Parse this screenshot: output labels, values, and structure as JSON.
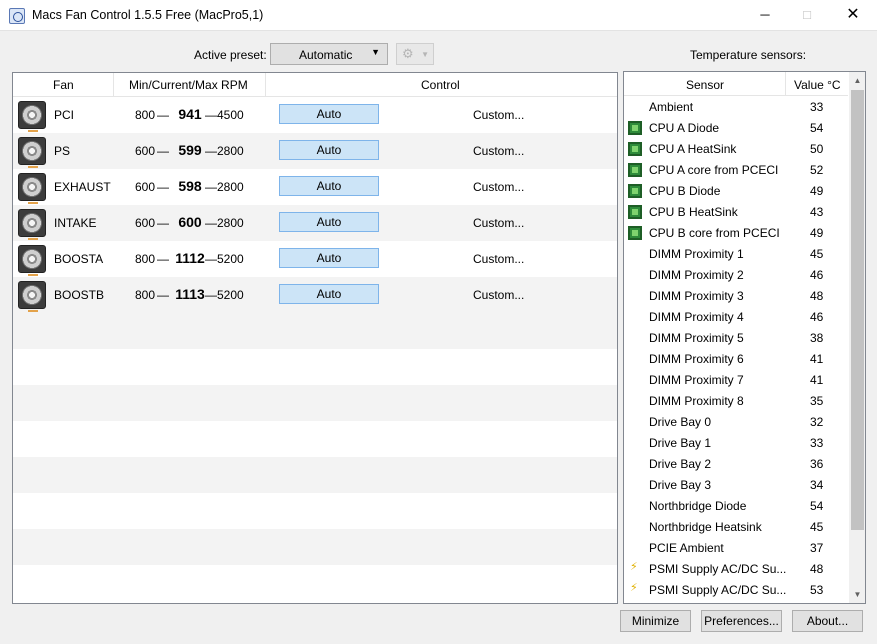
{
  "window": {
    "title": "Macs Fan Control 1.5.5 Free (MacPro5,1)",
    "minimize_glyph": "─",
    "maximize_glyph": "□",
    "close_glyph": "✕"
  },
  "toolbar": {
    "preset_label": "Active preset:",
    "preset_value": "Automatic",
    "dropdown_arrow": "▼",
    "gear_icon": "⚙",
    "temperature_label": "Temperature sensors:"
  },
  "fan_table": {
    "headers": {
      "fan": "Fan",
      "rpm": "Min/Current/Max RPM",
      "control": "Control"
    },
    "dash": "—",
    "fans": [
      {
        "name": "PCI",
        "min": "800",
        "current": "941",
        "max": "4500",
        "control": "Auto",
        "custom": "Custom..."
      },
      {
        "name": "PS",
        "min": "600",
        "current": "599",
        "max": "2800",
        "control": "Auto",
        "custom": "Custom..."
      },
      {
        "name": "EXHAUST",
        "min": "600",
        "current": "598",
        "max": "2800",
        "control": "Auto",
        "custom": "Custom..."
      },
      {
        "name": "INTAKE",
        "min": "600",
        "current": "600",
        "max": "2800",
        "control": "Auto",
        "custom": "Custom..."
      },
      {
        "name": "BOOSTA",
        "min": "800",
        "current": "1112",
        "max": "5200",
        "control": "Auto",
        "custom": "Custom..."
      },
      {
        "name": "BOOSTB",
        "min": "800",
        "current": "1113",
        "max": "5200",
        "control": "Auto",
        "custom": "Custom..."
      }
    ]
  },
  "sensor_table": {
    "headers": {
      "sensor": "Sensor",
      "value": "Value °C"
    },
    "sensors": [
      {
        "name": "Ambient",
        "value": "33",
        "icon": "none"
      },
      {
        "name": "CPU A Diode",
        "value": "54",
        "icon": "chip-icon"
      },
      {
        "name": "CPU A HeatSink",
        "value": "50",
        "icon": "chip-icon"
      },
      {
        "name": "CPU A core from PCECI",
        "value": "52",
        "icon": "chip-icon"
      },
      {
        "name": "CPU B Diode",
        "value": "49",
        "icon": "chip-icon"
      },
      {
        "name": "CPU B HeatSink",
        "value": "43",
        "icon": "chip-icon"
      },
      {
        "name": "CPU B core from PCECI",
        "value": "49",
        "icon": "chip-icon"
      },
      {
        "name": "DIMM Proximity 1",
        "value": "45",
        "icon": "none"
      },
      {
        "name": "DIMM Proximity 2",
        "value": "46",
        "icon": "none"
      },
      {
        "name": "DIMM Proximity 3",
        "value": "48",
        "icon": "none"
      },
      {
        "name": "DIMM Proximity 4",
        "value": "46",
        "icon": "none"
      },
      {
        "name": "DIMM Proximity 5",
        "value": "38",
        "icon": "none"
      },
      {
        "name": "DIMM Proximity 6",
        "value": "41",
        "icon": "none"
      },
      {
        "name": "DIMM Proximity 7",
        "value": "41",
        "icon": "none"
      },
      {
        "name": "DIMM Proximity 8",
        "value": "35",
        "icon": "none"
      },
      {
        "name": "Drive Bay 0",
        "value": "32",
        "icon": "none"
      },
      {
        "name": "Drive Bay 1",
        "value": "33",
        "icon": "none"
      },
      {
        "name": "Drive Bay 2",
        "value": "36",
        "icon": "none"
      },
      {
        "name": "Drive Bay 3",
        "value": "34",
        "icon": "none"
      },
      {
        "name": "Northbridge Diode",
        "value": "54",
        "icon": "none"
      },
      {
        "name": "Northbridge Heatsink",
        "value": "45",
        "icon": "none"
      },
      {
        "name": "PCIE Ambient",
        "value": "37",
        "icon": "none"
      },
      {
        "name": "PSMI Supply AC/DC Su...",
        "value": "48",
        "icon": "bolt-icon"
      },
      {
        "name": "PSMI Supply AC/DC Su...",
        "value": "53",
        "icon": "bolt-icon"
      }
    ],
    "scroll_up": "▲",
    "scroll_down": "▼"
  },
  "footer": {
    "minimize_label": "Minimize",
    "preferences_label": "Preferences...",
    "about_label": "About..."
  },
  "colors": {
    "auto_button_bg": "#cce4f7",
    "auto_button_border": "#7eb4ea",
    "chip_green": "#2e8b3a",
    "bolt_yellow": "#e0b000"
  }
}
